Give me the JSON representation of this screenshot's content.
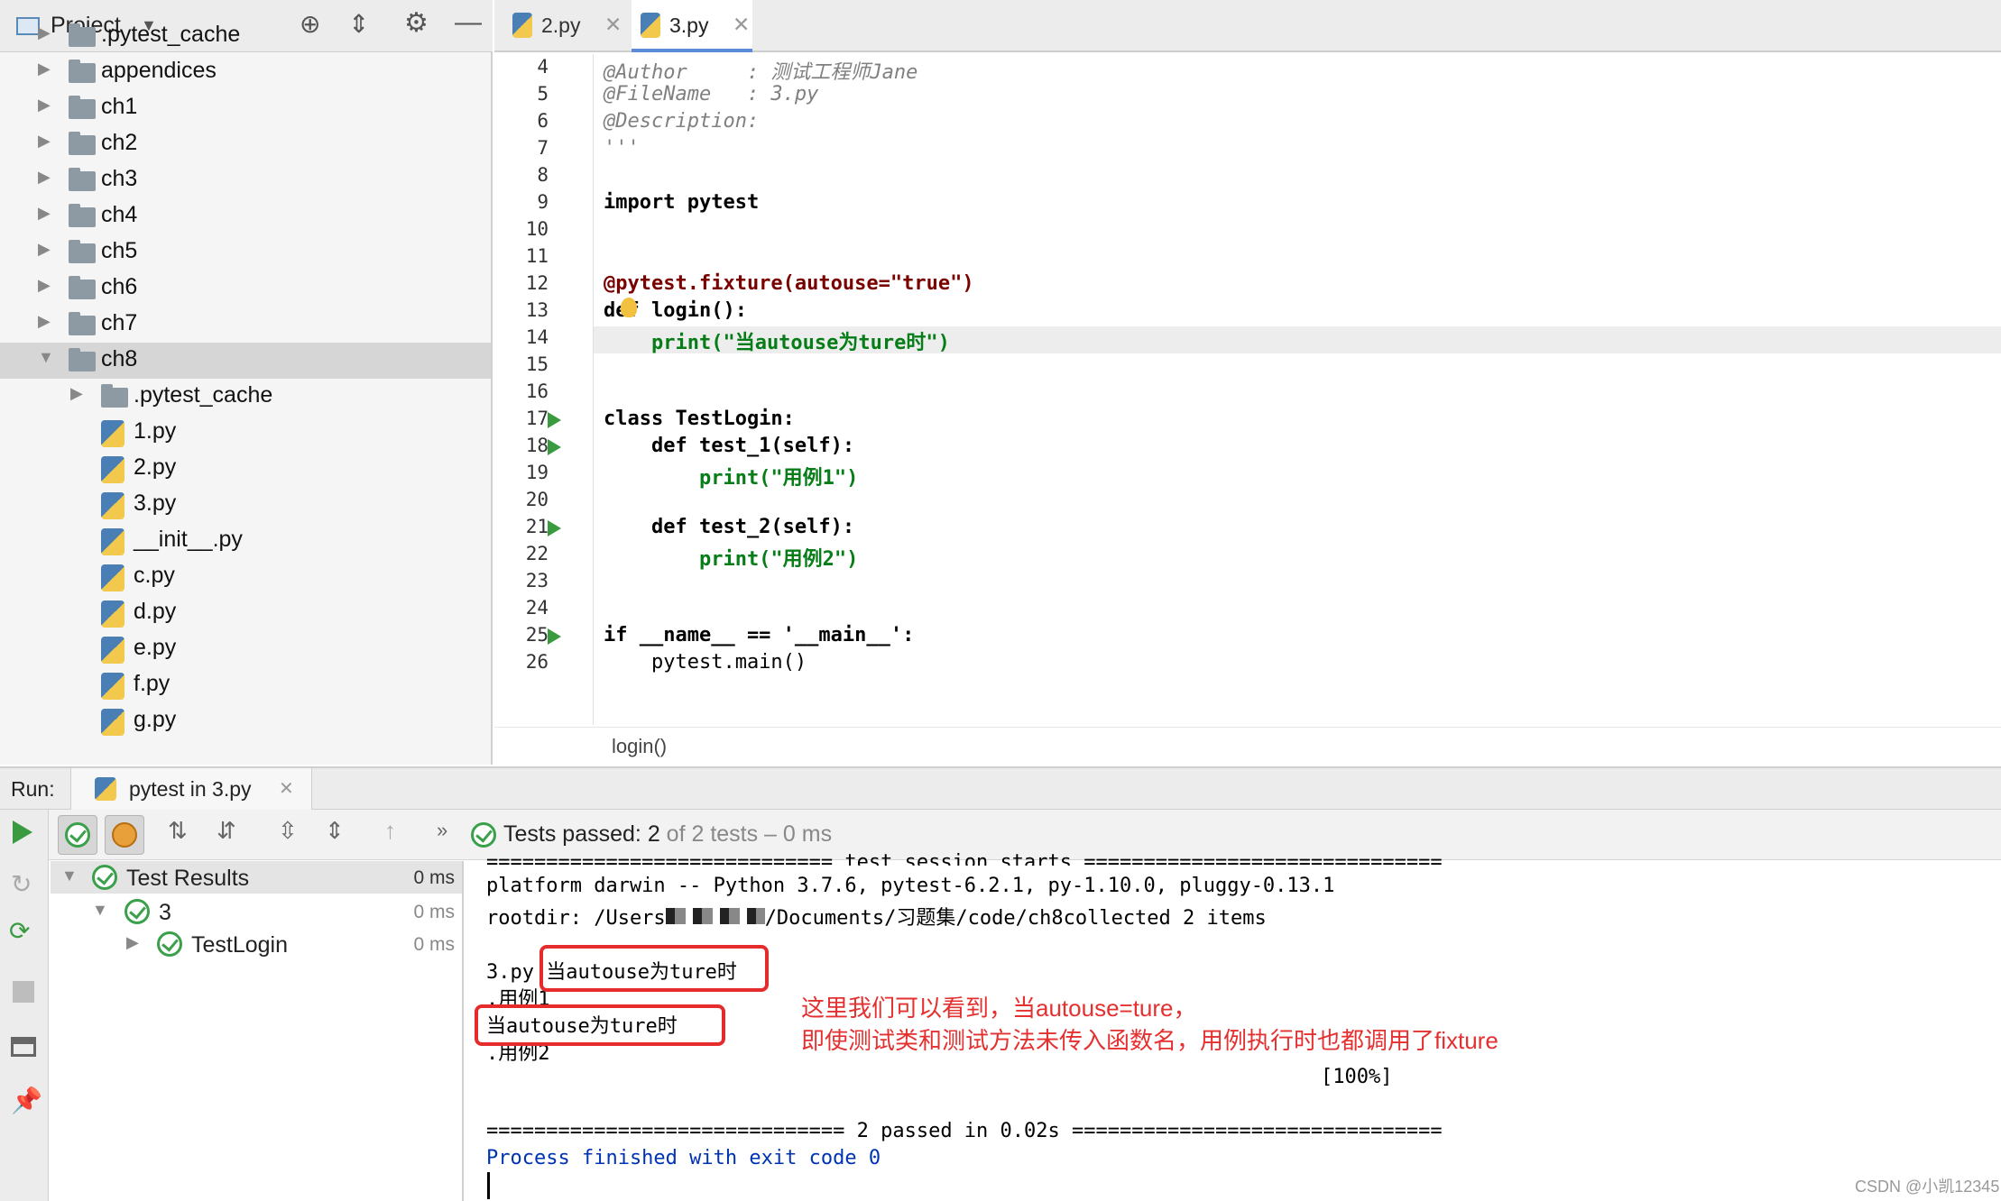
{
  "project_panel": {
    "title": "Project",
    "items": [
      {
        "label": ".pytest_cache",
        "type": "folder",
        "level": 0
      },
      {
        "label": "appendices",
        "type": "folder",
        "level": 0
      },
      {
        "label": "ch1",
        "type": "folder",
        "level": 0
      },
      {
        "label": "ch2",
        "type": "folder",
        "level": 0
      },
      {
        "label": "ch3",
        "type": "folder",
        "level": 0
      },
      {
        "label": "ch4",
        "type": "folder",
        "level": 0
      },
      {
        "label": "ch5",
        "type": "folder",
        "level": 0
      },
      {
        "label": "ch6",
        "type": "folder",
        "level": 0
      },
      {
        "label": "ch7",
        "type": "folder",
        "level": 0
      },
      {
        "label": "ch8",
        "type": "folder",
        "level": 0,
        "expanded": true,
        "selected": true
      },
      {
        "label": ".pytest_cache",
        "type": "folder",
        "level": 1
      },
      {
        "label": "1.py",
        "type": "file",
        "level": 1
      },
      {
        "label": "2.py",
        "type": "file",
        "level": 1
      },
      {
        "label": "3.py",
        "type": "file",
        "level": 1
      },
      {
        "label": "__init__.py",
        "type": "file",
        "level": 1
      },
      {
        "label": "c.py",
        "type": "file",
        "level": 1
      },
      {
        "label": "d.py",
        "type": "file",
        "level": 1
      },
      {
        "label": "e.py",
        "type": "file",
        "level": 1
      },
      {
        "label": "f.py",
        "type": "file",
        "level": 1
      },
      {
        "label": "g.py",
        "type": "file",
        "level": 1
      }
    ]
  },
  "editor": {
    "tabs": [
      {
        "label": "2.py",
        "active": false
      },
      {
        "label": "3.py",
        "active": true
      }
    ],
    "lines": [
      {
        "n": "4",
        "text": "@Author     : 测试工程师Jane"
      },
      {
        "n": "5",
        "text": "@FileName   : 3.py"
      },
      {
        "n": "6",
        "text": "@Description:"
      },
      {
        "n": "7",
        "text": "'''"
      },
      {
        "n": "8",
        "text": ""
      },
      {
        "n": "9",
        "text": "import pytest"
      },
      {
        "n": "10",
        "text": ""
      },
      {
        "n": "11",
        "text": ""
      },
      {
        "n": "12",
        "text": "@pytest.fixture(autouse=\"true\")"
      },
      {
        "n": "13",
        "text": "def login():"
      },
      {
        "n": "14",
        "text": "    print(\"当autouse为ture时\")"
      },
      {
        "n": "15",
        "text": ""
      },
      {
        "n": "16",
        "text": ""
      },
      {
        "n": "17",
        "text": "class TestLogin:"
      },
      {
        "n": "18",
        "text": "    def test_1(self):"
      },
      {
        "n": "19",
        "text": "        print(\"用例1\")"
      },
      {
        "n": "20",
        "text": ""
      },
      {
        "n": "21",
        "text": "    def test_2(self):"
      },
      {
        "n": "22",
        "text": "        print(\"用例2\")"
      },
      {
        "n": "23",
        "text": ""
      },
      {
        "n": "24",
        "text": ""
      },
      {
        "n": "25",
        "text": "if __name__ == '__main__':"
      },
      {
        "n": "26",
        "text": "    pytest.main()"
      }
    ],
    "breadcrumb": "login()"
  },
  "run_panel": {
    "label": "Run:",
    "tab": "pytest in 3.py",
    "status_passed": "Tests passed:",
    "status_count": "2",
    "status_rest": "of 2 tests – 0 ms",
    "results": [
      {
        "label": "Test Results",
        "time": "0 ms"
      },
      {
        "label": "3",
        "time": "0 ms"
      },
      {
        "label": "TestLogin",
        "time": "0 ms"
      }
    ],
    "console": {
      "l1": "============================= test session starts ==============================",
      "l2": "platform darwin -- Python 3.7.6, pytest-6.2.1, py-1.10.0, pluggy-0.13.1",
      "l3a": "rootdir: /Users",
      "l3b": "/Documents/习题集/code/ch8collected 2 items",
      "l4a": "3.py",
      "l4b": "当autouse为ture时",
      "l5": ".用例1",
      "l6": "当autouse为ture时",
      "l7": ".用例2",
      "l8": "[100%]",
      "l9": "============================== 2 passed in 0.02s ===============================",
      "l10": "Process finished with exit code 0"
    },
    "annotation_1": "这里我们可以看到，当autouse=ture，",
    "annotation_2": "即使测试类和测试方法未传入函数名，用例执行时也都调用了fixture",
    "watermark": "CSDN @小凯12345"
  },
  "colors": {
    "accent_green": "#3aa04a",
    "annotation_red": "#e53030"
  }
}
